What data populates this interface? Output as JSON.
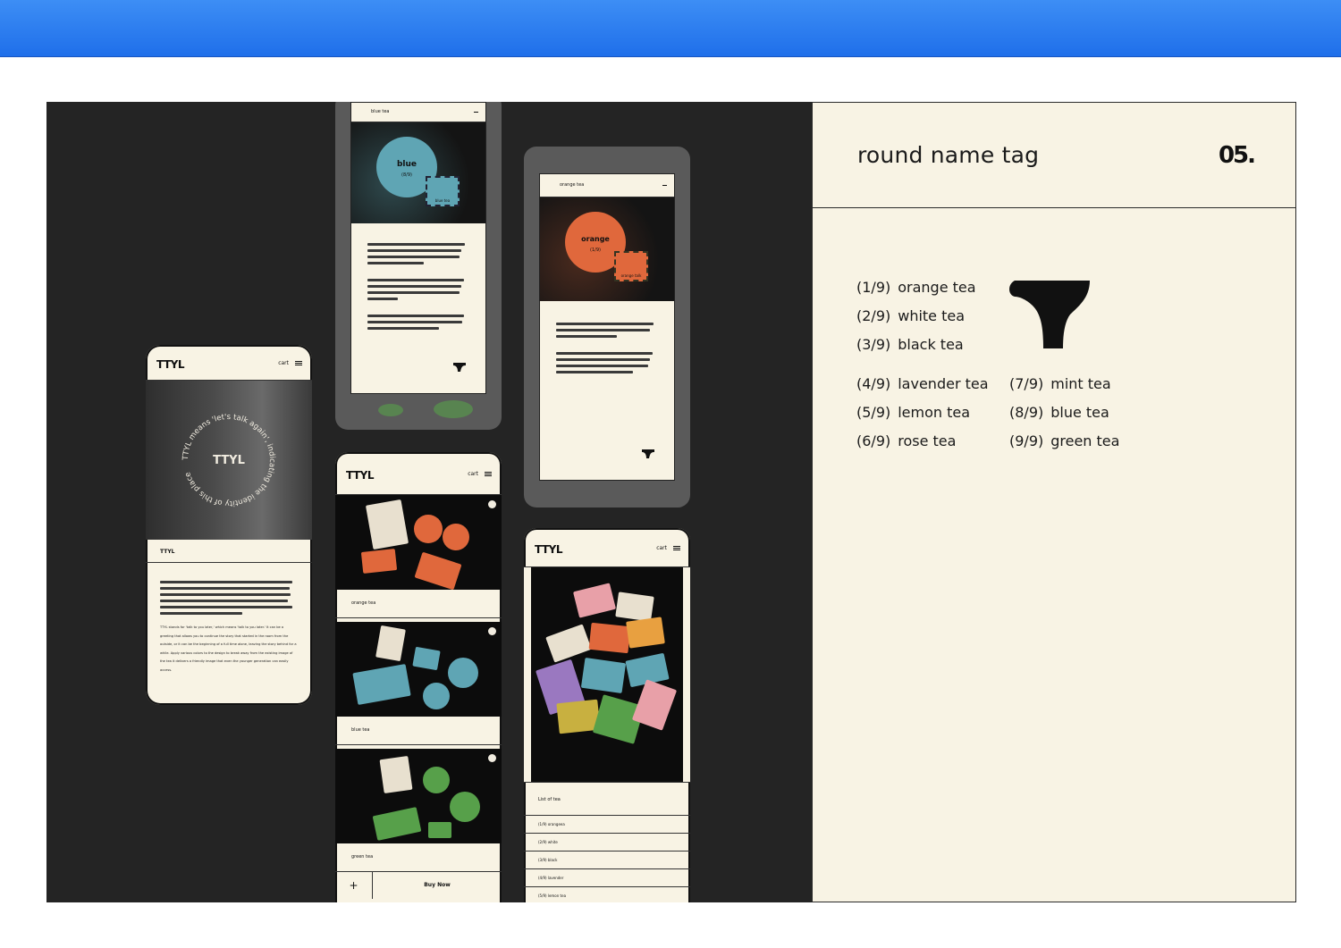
{
  "panel": {
    "title": "round name tag",
    "number": "05.",
    "teas_left": [
      {
        "num": "(1/9)",
        "name": "orange tea"
      },
      {
        "num": "(2/9)",
        "name": "white tea"
      },
      {
        "num": "(3/9)",
        "name": "black tea"
      },
      {
        "num": "(4/9)",
        "name": "lavender tea"
      },
      {
        "num": "(5/9)",
        "name": "lemon tea"
      },
      {
        "num": "(6/9)",
        "name": "rose tea"
      }
    ],
    "teas_right": [
      {
        "num": "(7/9)",
        "name": "mint tea"
      },
      {
        "num": "(8/9)",
        "name": "blue tea"
      },
      {
        "num": "(9/9)",
        "name": "green tea"
      }
    ]
  },
  "phone_home": {
    "brand": "TTYL",
    "cart": "cart",
    "ring_text": "TTYL means 'let's talk again', indicating the identity of this place",
    "section": "TTYL",
    "para_en": "TTYL stands for 'talk to you later,' which means 'talk to you later.' It can be a greeting that allows you to continue the story that started in the room from the outside, or it can be the beginning of a full time alone, leaving the story behind for a while. Apply various colors to the design to break away from the existing image of the tea it delivers a friendly image that even the younger generation can easily access."
  },
  "phone_blue": {
    "header": "blue tea",
    "tag_text": "talk to you later",
    "tag_label": "blue",
    "tag_count": "(8/9)",
    "stamp": "blue tea"
  },
  "phone_orange": {
    "header": "orange tea",
    "tag_text": "talk to you later",
    "tag_label": "orange",
    "tag_count": "(1/9)",
    "stamp": "orange talk"
  },
  "phone_products": {
    "brand": "TTYL",
    "cart": "cart",
    "items": [
      "orange tea",
      "blue tea",
      "green tea"
    ],
    "add": "+",
    "buy": "Buy Now"
  },
  "phone_list": {
    "brand": "TTYL",
    "cart": "cart",
    "list_title": "List of tea",
    "rows": [
      "(1/9) orangeea",
      "(2/9) white",
      "(3/9) black",
      "(4/9) lavender",
      "(5/9) lemon tea"
    ]
  },
  "colors": {
    "background": "#242424",
    "paper": "#f8f3e4",
    "orange": "#e0683c",
    "blue": "#5fa5b4",
    "green": "#57a04a",
    "accent_top": "#2a7cf0"
  }
}
